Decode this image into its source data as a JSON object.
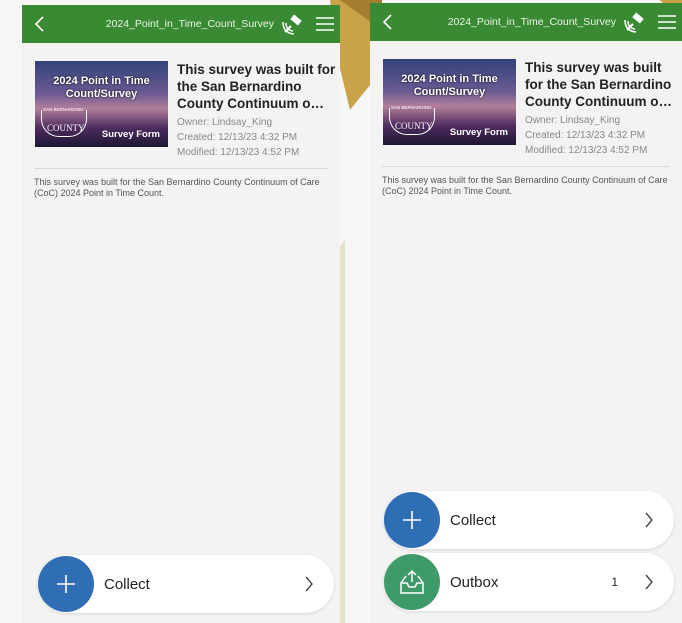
{
  "screens": [
    {
      "topbar": {
        "title": "2024_Point_in_Time_Count_Survey"
      },
      "survey": {
        "thumb_title": "2024 Point in Time Count/Survey",
        "thumb_org_small": "SAN BERNARDINO",
        "thumb_org": "COUNTY",
        "thumb_form": "Survey Form",
        "heading": "This survey was built for the San Bernardino County Continuum o…",
        "owner": "Owner: Lindsay_King",
        "created": "Created: 12/13/23 4:32 PM",
        "modified": "Modified: 12/13/23 4:52 PM",
        "description": "This survey was built for the San Bernardino County Continuum of Care (CoC) 2024 Point in Time Count."
      },
      "actions": {
        "collect_label": "Collect"
      }
    },
    {
      "topbar": {
        "title": "2024_Point_in_Time_Count_Survey"
      },
      "survey": {
        "thumb_title": "2024 Point in Time Count/Survey",
        "thumb_org_small": "SAN BERNARDINO",
        "thumb_org": "COUNTY",
        "thumb_form": "Survey Form",
        "heading": "This survey was built for the San Bernardino County Continuum o…",
        "owner": "Owner: Lindsay_King",
        "created": "Created: 12/13/23 4:32 PM",
        "modified": "Modified: 12/13/23 4:52 PM",
        "description": "This survey was built for the San Bernardino County Continuum of Care (CoC) 2024 Point in Time Count."
      },
      "actions": {
        "collect_label": "Collect",
        "outbox_label": "Outbox",
        "outbox_count": "1"
      }
    }
  ],
  "colors": {
    "topbar": "#3a8a33",
    "collect_circle": "#2f6db5",
    "outbox_circle": "#3f9a6a"
  },
  "icons": [
    "back-icon",
    "satellite-icon",
    "menu-icon",
    "plus-icon",
    "chevron-right-icon",
    "outbox-icon"
  ]
}
